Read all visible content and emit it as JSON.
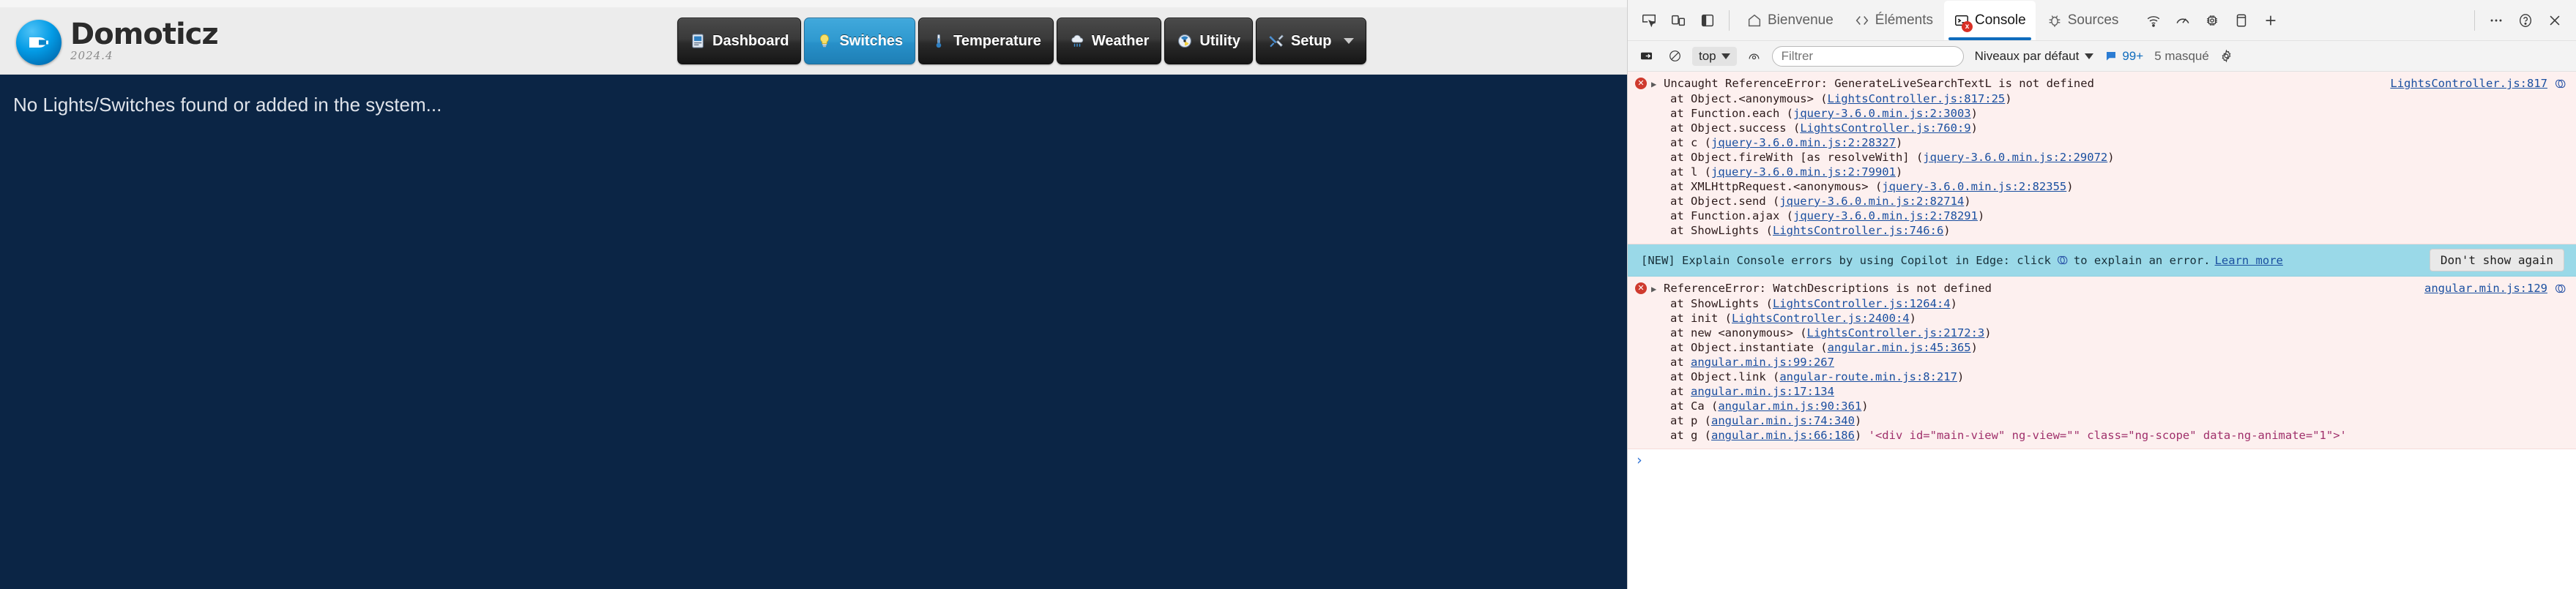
{
  "domoticz": {
    "brand": {
      "title": "Domoticz",
      "version": "2024.4",
      "logo_icon": "domoticz-logo-icon"
    },
    "nav": [
      {
        "label": "Dashboard",
        "icon": "dashboard-icon",
        "active": false,
        "caret": false
      },
      {
        "label": "Switches",
        "icon": "lightbulb-icon",
        "active": true,
        "caret": false
      },
      {
        "label": "Temperature",
        "icon": "thermometer-icon",
        "active": false,
        "caret": false
      },
      {
        "label": "Weather",
        "icon": "cloud-rain-icon",
        "active": false,
        "caret": false
      },
      {
        "label": "Utility",
        "icon": "gauge-icon",
        "active": false,
        "caret": false
      },
      {
        "label": "Setup",
        "icon": "tools-icon",
        "active": false,
        "caret": true
      }
    ],
    "content": {
      "message": "No Lights/Switches found or added in the system..."
    },
    "colors": {
      "body_bg": "#0b2545",
      "navbar_bg": "#ececec",
      "active_tab": "#2f99cf"
    }
  },
  "devtools": {
    "toolbar": {
      "left_icons": [
        {
          "name": "inspect-element-icon"
        },
        {
          "name": "device-toolbar-icon"
        },
        {
          "name": "dock-side-icon"
        }
      ],
      "tabs": [
        {
          "label": "Bienvenue",
          "icon": "home-icon",
          "selected": false,
          "badge": ""
        },
        {
          "label": "Éléments",
          "icon": "code-icon",
          "selected": false,
          "badge": ""
        },
        {
          "label": "Console",
          "icon": "console-icon",
          "selected": true,
          "badge": "x"
        },
        {
          "label": "Sources",
          "icon": "bug-icon",
          "selected": false,
          "badge": ""
        }
      ],
      "right_icons": [
        {
          "name": "network-icon"
        },
        {
          "name": "performance-icon"
        },
        {
          "name": "memory-icon"
        },
        {
          "name": "application-icon"
        },
        {
          "name": "more-tabs-plus-icon"
        }
      ],
      "end_icons": [
        {
          "name": "more-options-icon"
        },
        {
          "name": "help-icon"
        },
        {
          "name": "close-devtools-icon"
        }
      ]
    },
    "filterbar": {
      "sidebar_toggle_icon": "console-sidebar-icon",
      "clear_icon": "clear-console-icon",
      "context": "top",
      "eye_icon": "live-expression-icon",
      "filter_placeholder": "Filtrer",
      "filter_value": "",
      "levels_label": "Niveaux par défaut",
      "issues_count": "99+",
      "issues_icon": "issues-icon",
      "hidden_label": "5 masqué",
      "settings_icon": "gear-icon"
    },
    "messages": [
      {
        "kind": "error",
        "title": "Uncaught ReferenceError: GenerateLiveSearchTextL is not defined",
        "source_link": "LightsController.js:817",
        "explain_icon": "copilot-explain-icon",
        "stack": [
          {
            "prefix": "at Object.<anonymous> (",
            "link": "LightsController.js:817:25",
            "suffix": ")"
          },
          {
            "prefix": "at Function.each (",
            "link": "jquery-3.6.0.min.js:2:3003",
            "suffix": ")"
          },
          {
            "prefix": "at Object.success (",
            "link": "LightsController.js:760:9",
            "suffix": ")"
          },
          {
            "prefix": "at c (",
            "link": "jquery-3.6.0.min.js:2:28327",
            "suffix": ")"
          },
          {
            "prefix": "at Object.fireWith [as resolveWith] (",
            "link": "jquery-3.6.0.min.js:2:29072",
            "suffix": ")"
          },
          {
            "prefix": "at l (",
            "link": "jquery-3.6.0.min.js:2:79901",
            "suffix": ")"
          },
          {
            "prefix": "at XMLHttpRequest.<anonymous> (",
            "link": "jquery-3.6.0.min.js:2:82355",
            "suffix": ")"
          },
          {
            "prefix": "at Object.send (",
            "link": "jquery-3.6.0.min.js:2:82714",
            "suffix": ")"
          },
          {
            "prefix": "at Function.ajax (",
            "link": "jquery-3.6.0.min.js:2:78291",
            "suffix": ")"
          },
          {
            "prefix": "at ShowLights (",
            "link": "LightsController.js:746:6",
            "suffix": ")"
          }
        ]
      },
      {
        "kind": "error",
        "title": "ReferenceError: WatchDescriptions is not defined",
        "source_link": "angular.min.js:129",
        "explain_icon": "copilot-explain-icon",
        "stack": [
          {
            "prefix": "at ShowLights (",
            "link": "LightsController.js:1264:4",
            "suffix": ")"
          },
          {
            "prefix": "at init (",
            "link": "LightsController.js:2400:4",
            "suffix": ")"
          },
          {
            "prefix": "at new <anonymous> (",
            "link": "LightsController.js:2172:3",
            "suffix": ")"
          },
          {
            "prefix": "at Object.instantiate (",
            "link": "angular.min.js:45:365",
            "suffix": ")"
          },
          {
            "prefix": "at ",
            "link": "angular.min.js:99:267",
            "suffix": ""
          },
          {
            "prefix": "at Object.link (",
            "link": "angular-route.min.js:8:217",
            "suffix": ")"
          },
          {
            "prefix": "at ",
            "link": "angular.min.js:17:134",
            "suffix": ""
          },
          {
            "prefix": "at Ca (",
            "link": "angular.min.js:90:361",
            "suffix": ")"
          },
          {
            "prefix": "at p (",
            "link": "angular.min.js:74:340",
            "suffix": ")"
          },
          {
            "prefix": "at g (",
            "link": "angular.min.js:66:186",
            "suffix": ")",
            "snippet": " '<div id=\"main-view\" ng-view=\"\" class=\"ng-scope\" data-ng-animate=\"1\">'"
          }
        ]
      }
    ],
    "copilot_banner": {
      "prefix": "[NEW] Explain Console errors by using Copilot in Edge: click",
      "icon": "copilot-explain-icon",
      "suffix": "to explain an error.",
      "learn_more": "Learn more",
      "dismiss": "Don't show again",
      "bg": "#9ad9e8"
    },
    "prompt": {
      "chevron": "›"
    }
  }
}
